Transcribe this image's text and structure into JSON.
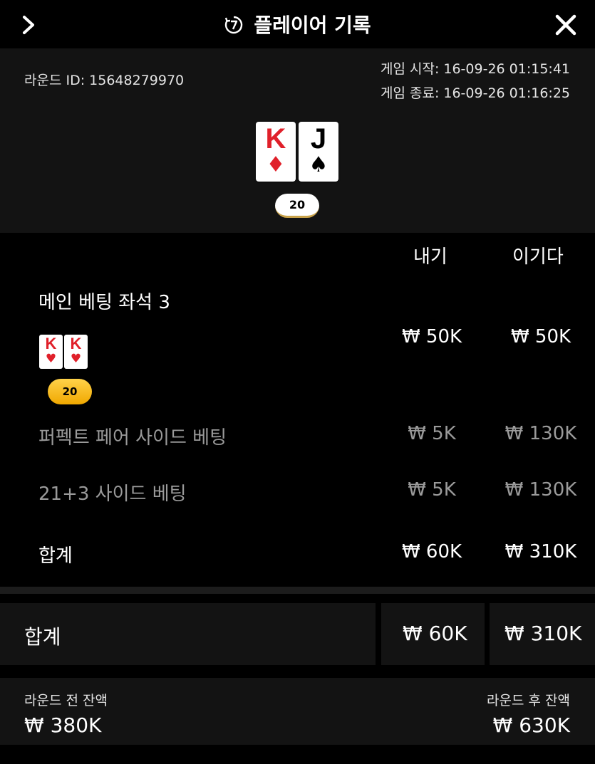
{
  "header": {
    "title": "플레이어 기록",
    "back_icon": "chevron-right-icon",
    "history_icon": "history-clock-icon",
    "close_icon": "close-icon"
  },
  "round": {
    "round_id": "라운드 ID: 15648279970",
    "start": "게임 시작: 16-09-26 01:15:41",
    "end": "게임 종료: 16-09-26 01:16:25",
    "dealer_cards": [
      {
        "rank": "K",
        "suit": "♦",
        "color": "#e0202a"
      },
      {
        "rank": "J",
        "suit": "♠",
        "color": "#000000"
      }
    ],
    "dealer_score": "20"
  },
  "bets": {
    "col_bet": "내기",
    "col_win": "이기다",
    "main": {
      "label": "메인 베팅 좌석 3",
      "bet": "₩ 50K",
      "win": "₩ 50K",
      "cards": [
        {
          "rank": "K",
          "suit": "♥"
        },
        {
          "rank": "K",
          "suit": "♥"
        }
      ],
      "score": "20"
    },
    "perfect_pair": {
      "label": "퍼펙트 페어 사이드 베팅",
      "bet": "₩ 5K",
      "win": "₩ 130K"
    },
    "twenty_one_three": {
      "label": "21+3 사이드 베팅",
      "bet": "₩ 5K",
      "win": "₩ 130K"
    },
    "subtotal": {
      "label": "합계",
      "bet": "₩ 60K",
      "win": "₩ 310K"
    }
  },
  "totals": {
    "label": "합계",
    "bet": "₩ 60K",
    "win": "₩ 310K"
  },
  "balance": {
    "before_label": "라운드 전 잔액",
    "before_value": "₩ 380K",
    "after_label": "라운드 후 잔액",
    "after_value": "₩ 630K"
  },
  "colors": {
    "accent_gold": "#f0b400",
    "card_red": "#e0202a",
    "panel": "#131313"
  }
}
